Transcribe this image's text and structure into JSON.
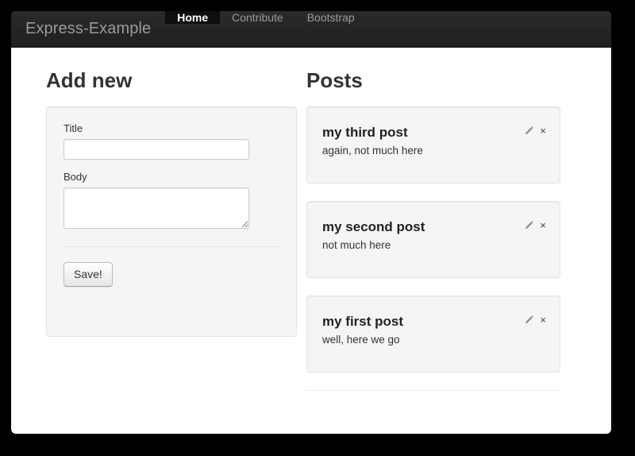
{
  "navbar": {
    "brand": "Express-Example",
    "items": [
      {
        "label": "Home",
        "active": true
      },
      {
        "label": "Contribute",
        "active": false
      },
      {
        "label": "Bootstrap",
        "active": false
      }
    ]
  },
  "add_new": {
    "heading": "Add new",
    "title_label": "Title",
    "title_value": "",
    "title_placeholder": "",
    "body_label": "Body",
    "body_value": "",
    "body_placeholder": "",
    "save_label": "Save!"
  },
  "posts_section": {
    "heading": "Posts",
    "posts": [
      {
        "title": "my third post",
        "body": "again, not much here",
        "edit_icon": "pencil-icon",
        "delete_icon": "close-icon",
        "delete_glyph": "×"
      },
      {
        "title": "my second post",
        "body": "not much here",
        "edit_icon": "pencil-icon",
        "delete_icon": "close-icon",
        "delete_glyph": "×"
      },
      {
        "title": "my first post",
        "body": "well, here we go",
        "edit_icon": "pencil-icon",
        "delete_icon": "close-icon",
        "delete_glyph": "×"
      }
    ]
  },
  "colors": {
    "navbar_bg": "#222222",
    "navbar_active_bg": "#111111",
    "navbar_text": "#999999",
    "navbar_active_text": "#ffffff",
    "page_bg": "#ffffff",
    "outer_bg": "#000000",
    "well_bg": "#f5f5f5",
    "well_border": "#e3e3e3",
    "heading_text": "#333333"
  }
}
